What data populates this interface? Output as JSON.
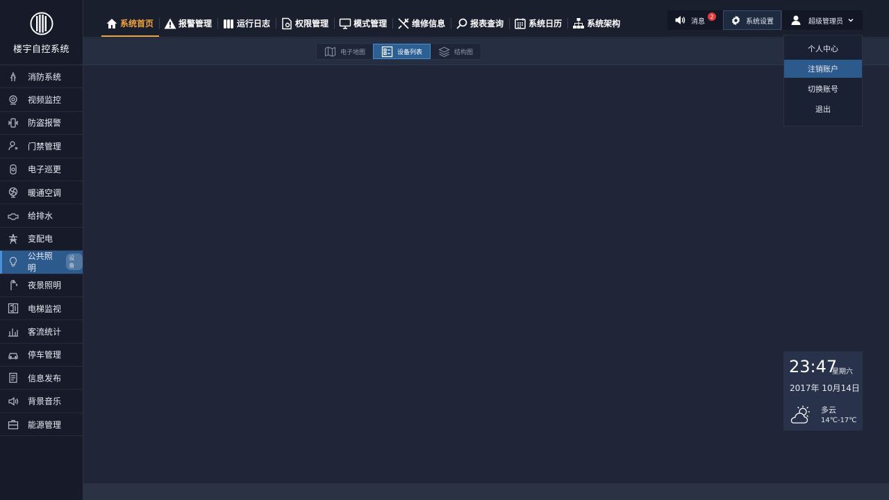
{
  "brand": {
    "name": "楼宇自控系统"
  },
  "sidebar": {
    "items": [
      {
        "label": "消防系统",
        "icon": "fire-hydrant-icon"
      },
      {
        "label": "视频监控",
        "icon": "camera-icon"
      },
      {
        "label": "防盗报警",
        "icon": "alarm-vibrate-icon"
      },
      {
        "label": "门禁管理",
        "icon": "door-access-icon"
      },
      {
        "label": "电子巡更",
        "icon": "patrol-device-icon"
      },
      {
        "label": "暖通空调",
        "icon": "fan-icon"
      },
      {
        "label": "给排水",
        "icon": "pipe-icon"
      },
      {
        "label": "变配电",
        "icon": "power-tower-icon"
      },
      {
        "label": "公共照明",
        "icon": "bulb-icon",
        "badge": "设备"
      },
      {
        "label": "夜景照明",
        "icon": "street-lamp-icon"
      },
      {
        "label": "电梯监视",
        "icon": "elevator-icon"
      },
      {
        "label": "客流统计",
        "icon": "bar-chart-icon"
      },
      {
        "label": "停车管理",
        "icon": "car-icon"
      },
      {
        "label": "信息发布",
        "icon": "document-icon"
      },
      {
        "label": "背景音乐",
        "icon": "speaker-icon"
      },
      {
        "label": "能源管理",
        "icon": "briefcase-icon"
      }
    ],
    "active_index": 8
  },
  "topnav": {
    "items": [
      {
        "label": "系统首页",
        "icon": "home-icon"
      },
      {
        "label": "报警管理",
        "icon": "warning-icon"
      },
      {
        "label": "运行日志",
        "icon": "log-icon"
      },
      {
        "label": "权限管理",
        "icon": "permission-icon"
      },
      {
        "label": "模式管理",
        "icon": "monitor-icon"
      },
      {
        "label": "维修信息",
        "icon": "tools-icon"
      },
      {
        "label": "报表查询",
        "icon": "search-icon"
      },
      {
        "label": "系统日历",
        "icon": "calendar-icon"
      },
      {
        "label": "系统架构",
        "icon": "org-chart-icon"
      }
    ],
    "active_index": 0
  },
  "top_right": {
    "messages_label": "消息",
    "messages_count": "2",
    "settings_label": "系统设置",
    "user_label": "超级管理员"
  },
  "user_menu": {
    "items": [
      "个人中心",
      "注销账户",
      "切换账号",
      "退出"
    ],
    "highlighted_index": 1
  },
  "view_tabs": {
    "items": [
      {
        "label": "电子地图",
        "icon": "map-icon"
      },
      {
        "label": "设备列表",
        "icon": "list-icon"
      },
      {
        "label": "结构图",
        "icon": "layers-icon"
      }
    ],
    "active_index": 1
  },
  "clock": {
    "time": "23:47",
    "weekday": "星期六",
    "date": "2017年 10月14日",
    "weather": "多云",
    "temperature": "14℃-17℃",
    "weather_icon": "sun-cloud-icon"
  },
  "colors": {
    "accent_orange": "#f0a23c",
    "active_blue": "#2c5a8c",
    "badge_red": "#e03b3b"
  }
}
